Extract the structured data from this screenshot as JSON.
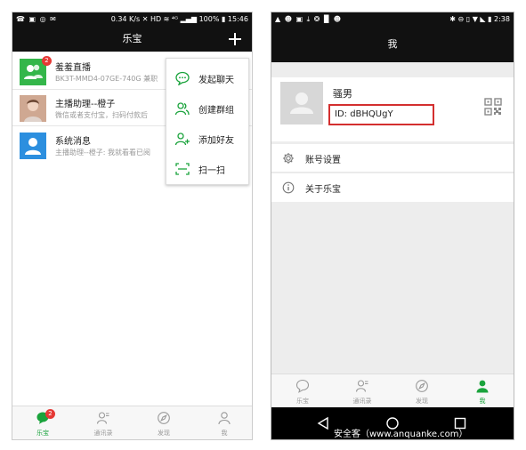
{
  "left_screen": {
    "status_left": "☎ ▣ ◎ ✉",
    "status_right": "0.34 K/s ✕ HD ≋ ⁴ᴳ ▂▄▆ 100% ▮ 15:46",
    "title": "乐宝",
    "conversations": [
      {
        "name": "羞羞直播",
        "preview": "BK3T-MMD4-07GE-740G 兼职",
        "badge": "2"
      },
      {
        "name": "主播助理--橙子",
        "preview": "微信或者支付宝，扫码付款后"
      },
      {
        "name": "系统消息",
        "preview": "主播助理--橙子: 我就看看已阅"
      }
    ],
    "popup_menu": [
      "发起聊天",
      "创建群组",
      "添加好友",
      "扫一扫"
    ],
    "tabs": [
      "乐宝",
      "通讯录",
      "发现",
      "我"
    ],
    "tab_badge": "2"
  },
  "right_screen": {
    "status_left": "▲ ☻ ▣ ⤓ ❂ ▉ ☻",
    "status_right": "✱ ⊖ ▯ ▼ ◣ ▮ 2:38",
    "title": "我",
    "nickname": "骚男",
    "user_id": "ID: dBHQUgY",
    "menu": [
      "账号设置",
      "关于乐宝"
    ],
    "tabs": [
      "乐宝",
      "通讯录",
      "发现",
      "我"
    ]
  },
  "watermark": "安全客（www.anquanke.com）",
  "colors": {
    "accent": "#1aa33c",
    "highlight": "#d32f2f",
    "bar": "#111111"
  }
}
